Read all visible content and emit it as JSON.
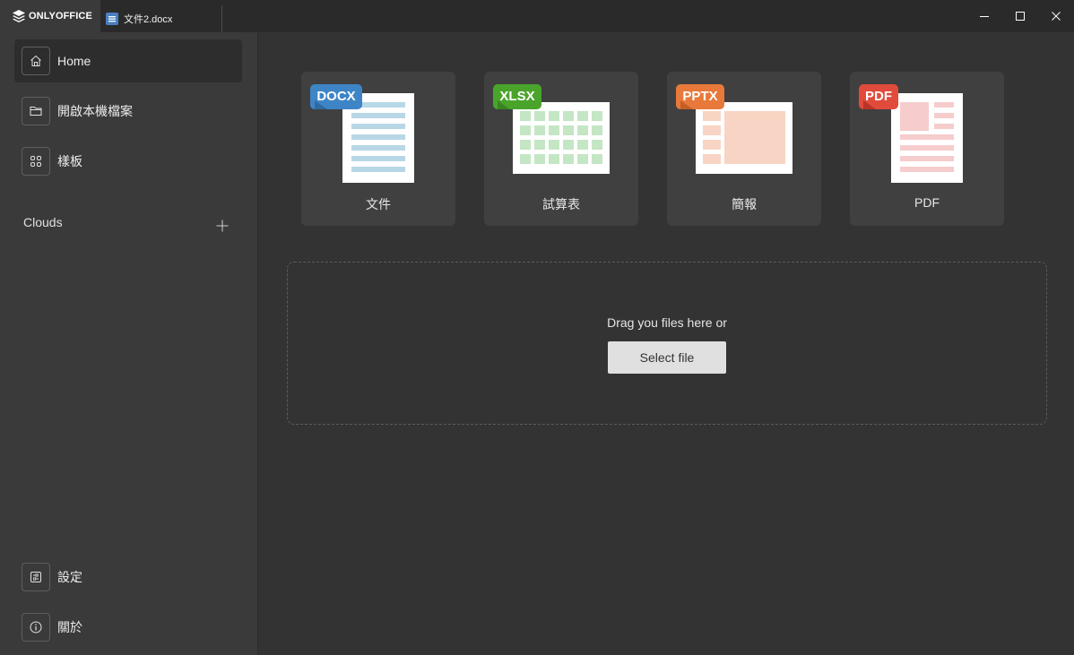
{
  "titlebar": {
    "brand": "ONLYOFFICE",
    "tab_name": "文件2.docx",
    "icons": {
      "brand": "onlyoffice-logo-icon",
      "tab": "document-icon",
      "minimize": "minimize-icon",
      "maximize": "maximize-icon",
      "close": "close-icon"
    }
  },
  "sidebar": {
    "items": [
      {
        "label": "Home",
        "icon": "home-icon",
        "active": true
      },
      {
        "label": "開啟本機檔案",
        "icon": "folder-icon",
        "active": false
      },
      {
        "label": "樣板",
        "icon": "grid-icon",
        "active": false
      }
    ],
    "clouds_label": "Clouds",
    "clouds_add_icon": "plus-icon",
    "bottom_items": [
      {
        "label": "設定",
        "icon": "settings-icon"
      },
      {
        "label": "關於",
        "icon": "info-icon"
      }
    ]
  },
  "main": {
    "create_cards": [
      {
        "badge": "DOCX",
        "label": "文件",
        "color": "#3d85c6"
      },
      {
        "badge": "XLSX",
        "label": "試算表",
        "color": "#4aa42c"
      },
      {
        "badge": "PPTX",
        "label": "簡報",
        "color": "#e8793a"
      },
      {
        "badge": "PDF",
        "label": "PDF",
        "color": "#e04b3b"
      }
    ],
    "dropzone": {
      "text": "Drag you files here or",
      "button": "Select file"
    }
  },
  "colors": {
    "background": "#333333",
    "sidebar": "#3a3a3a",
    "card": "#404040",
    "titlebar": "#2a2a2a"
  }
}
